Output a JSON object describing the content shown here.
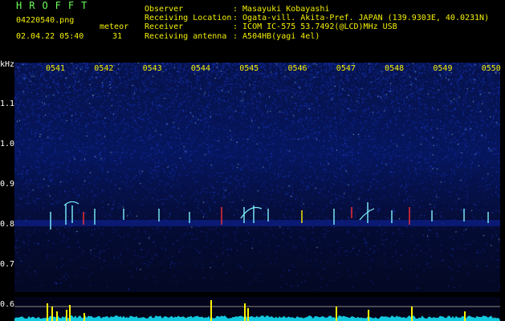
{
  "app": {
    "title": "HROFFT"
  },
  "file": {
    "name": "04220540.png",
    "date_time": "02.04.22 05:40",
    "meteor_label": "meteor",
    "meteor_count": "31"
  },
  "station": {
    "rows": [
      {
        "label": "Observer",
        "value": ": Masayuki Kobayashi"
      },
      {
        "label": "Receiving Location",
        "value": ": Ogata-vill. Akita-Pref. JAPAN (139.9303E, 40.0231N)"
      },
      {
        "label": "Receiver",
        "value": ": ICOM IC-575 53.7492(@LCD)MHz USB"
      },
      {
        "label": "Receiving antenna",
        "value": ": A504HB(yagi 4el)"
      }
    ]
  },
  "axes": {
    "unit": "kHz",
    "time_labels": [
      "0541",
      "0542",
      "0543",
      "0544",
      "0545",
      "0546",
      "0547",
      "0548",
      "0549",
      "0550"
    ],
    "freq_labels": [
      "1.1",
      "1.0",
      "0.9",
      "0.8",
      "0.7",
      "0.6"
    ]
  },
  "colors": {
    "title_green": "#6cff5a",
    "label_yellow": "#f4f000",
    "noise_blue": "#2a4cff",
    "echo_cyan": "#7df3ff",
    "echo_red": "#ff3030",
    "echo_yellow": "#fff200",
    "meter_cyan": "#13c9e0"
  }
}
